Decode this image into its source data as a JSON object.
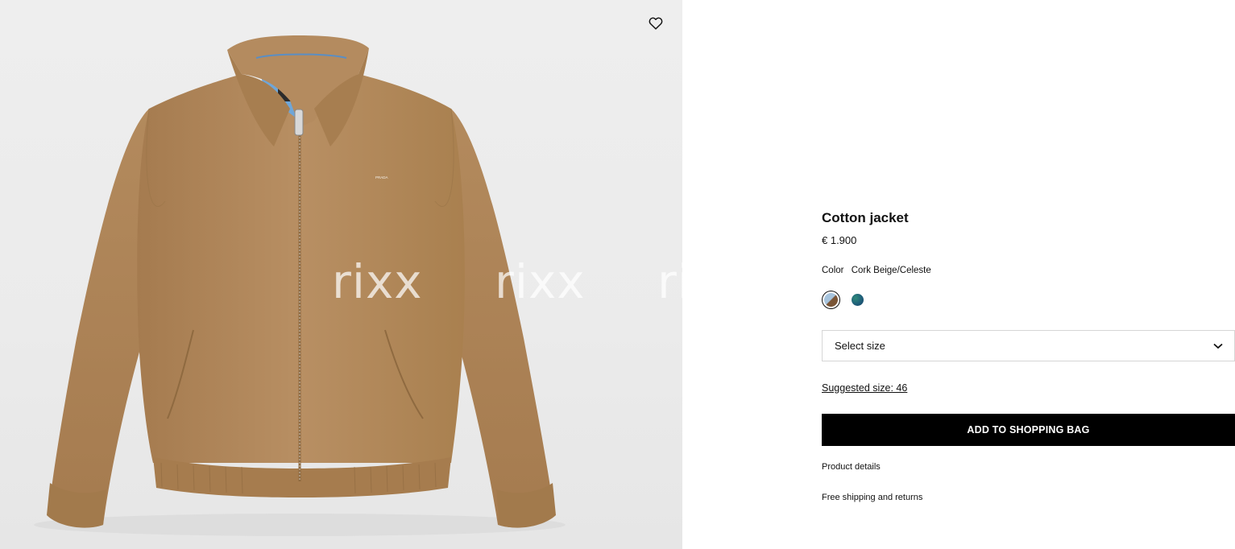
{
  "product": {
    "title": "Cotton jacket",
    "price": "€ 1.900",
    "color_label": "Color",
    "color_value": "Cork Beige/Celeste",
    "swatches": [
      {
        "name": "Cork Beige/Celeste",
        "colors": [
          "#a7c4dd",
          "#7a5536"
        ],
        "selected": true
      },
      {
        "name": "teal-blue",
        "colors": [
          "#2f8a7a",
          "#163f64"
        ],
        "selected": false
      }
    ],
    "size_placeholder": "Select size",
    "suggested_size": "Suggested size: 46",
    "add_to_bag": "ADD TO SHOPPING BAG",
    "product_details": "Product details",
    "shipping": "Free shipping and returns"
  },
  "image": {
    "logo_text": "PRADA",
    "watermark": [
      "rixx",
      "rixx",
      "ri"
    ],
    "wishlist_icon": "heart-icon",
    "colors": {
      "jacket": "#b48b5f",
      "lining": "#6fa6d8",
      "background": "#ececec"
    }
  }
}
